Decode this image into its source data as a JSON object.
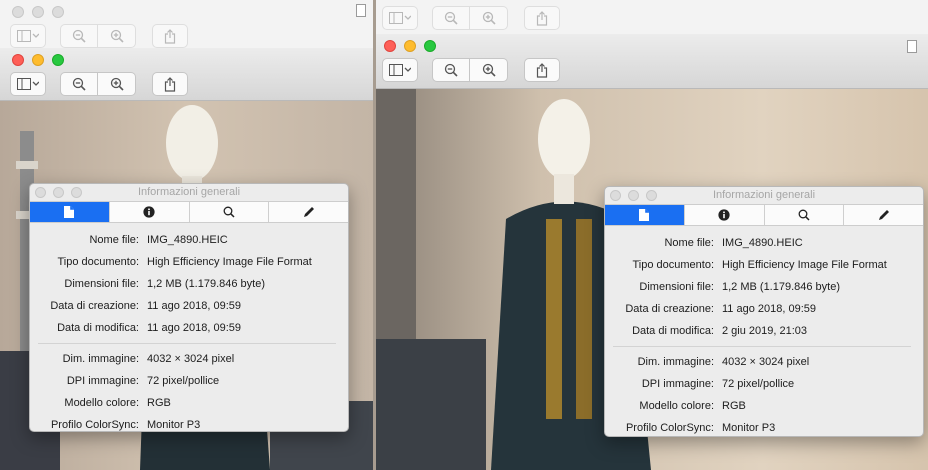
{
  "window_left": {
    "toolbar": {
      "zoom_out_icon": "magnifier-minus",
      "zoom_in_icon": "magnifier-plus",
      "share_icon": "share-box-arrow"
    }
  },
  "window_right": {
    "toolbar": {
      "zoom_out_icon": "magnifier-minus",
      "zoom_in_icon": "magnifier-plus",
      "share_icon": "share-box-arrow"
    }
  },
  "inspector_left": {
    "title": "Informazioni generali",
    "tabs": [
      "document-icon",
      "info-icon",
      "search-icon",
      "pencil-icon"
    ],
    "general": [
      {
        "label": "Nome file:",
        "value": "IMG_4890.HEIC"
      },
      {
        "label": "Tipo documento:",
        "value": "High Efficiency Image File Format"
      },
      {
        "label": "Dimensioni file:",
        "value": "1,2 MB (1.179.846 byte)"
      },
      {
        "label": "Data di creazione:",
        "value": "11 ago 2018, 09:59"
      },
      {
        "label": "Data di modifica:",
        "value": "11 ago 2018, 09:59"
      }
    ],
    "image": [
      {
        "label": "Dim. immagine:",
        "value": "4032 × 3024 pixel"
      },
      {
        "label": "DPI immagine:",
        "value": "72 pixel/pollice"
      },
      {
        "label": "Modello colore:",
        "value": "RGB"
      },
      {
        "label": "Profilo ColorSync:",
        "value": "Monitor P3"
      }
    ]
  },
  "inspector_right": {
    "title": "Informazioni generali",
    "tabs": [
      "document-icon",
      "info-icon",
      "search-icon",
      "pencil-icon"
    ],
    "general": [
      {
        "label": "Nome file:",
        "value": "IMG_4890.HEIC"
      },
      {
        "label": "Tipo documento:",
        "value": "High Efficiency Image File Format"
      },
      {
        "label": "Dimensioni file:",
        "value": "1,2 MB (1.179.846 byte)"
      },
      {
        "label": "Data di creazione:",
        "value": "11 ago 2018, 09:59"
      },
      {
        "label": "Data di modifica:",
        "value": "2 giu 2019, 21:03"
      }
    ],
    "image": [
      {
        "label": "Dim. immagine:",
        "value": "4032 × 3024 pixel"
      },
      {
        "label": "DPI immagine:",
        "value": "72 pixel/pollice"
      },
      {
        "label": "Modello colore:",
        "value": "RGB"
      },
      {
        "label": "Profilo ColorSync:",
        "value": "Monitor P3"
      }
    ]
  },
  "colors": {
    "accent": "#1a6ff2",
    "close": "#fe5f57",
    "minimize": "#febc2e",
    "zoom": "#28c840"
  }
}
